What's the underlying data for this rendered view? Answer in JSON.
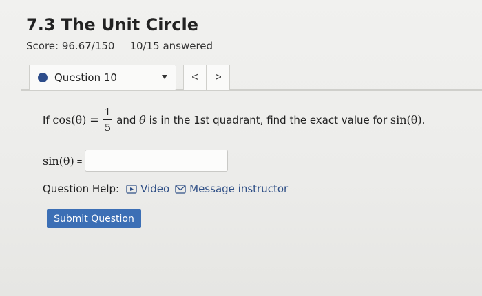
{
  "header": {
    "title": "7.3 The Unit Circle",
    "score": "Score: 96.67/150",
    "answered": "10/15 answered"
  },
  "nav": {
    "question_label": "Question 10",
    "prev": "<",
    "next": ">"
  },
  "question": {
    "prefix": "If",
    "lhs": "cos(θ)",
    "equals": "=",
    "numerator": "1",
    "denominator": "5",
    "text_and": "and",
    "theta": "θ",
    "text_mid": "is in the 1st quadrant, find the exact value for",
    "target": "sin(θ)",
    "end": "."
  },
  "answer": {
    "label": "sin(θ)",
    "equals": "=",
    "value": ""
  },
  "help": {
    "label": "Question Help:",
    "video": "Video",
    "message": "Message instructor"
  },
  "submit_label": "Submit Question",
  "colors": {
    "accent": "#3c6fb5",
    "link": "#2f4f86",
    "question_dot": "#2c4c8a"
  }
}
